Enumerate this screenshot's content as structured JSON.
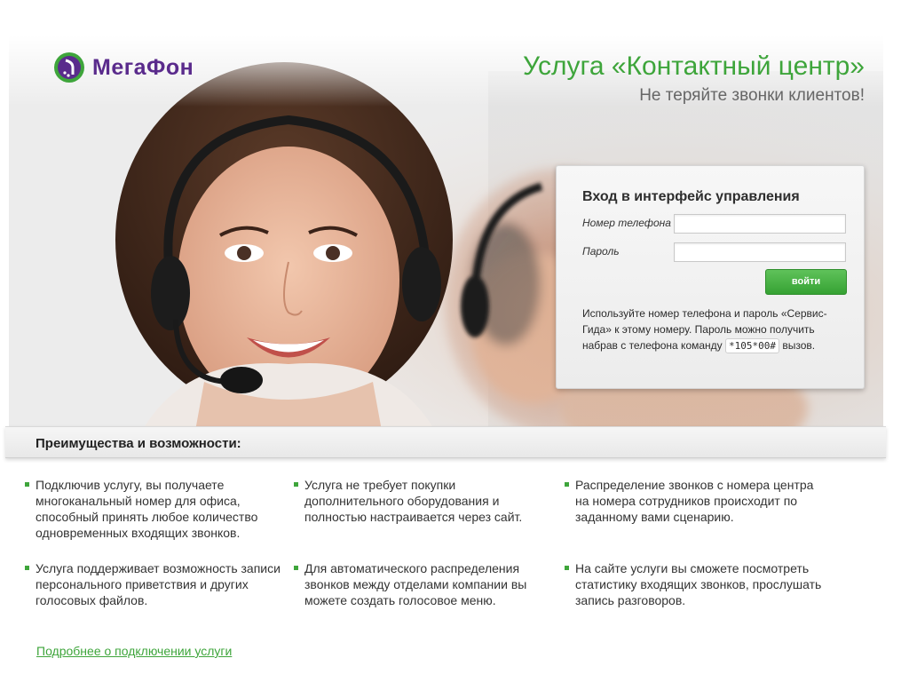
{
  "brand": {
    "name": "МегаФон"
  },
  "header": {
    "title": "Услуга «Контактный центр»",
    "subtitle": "Не теряйте звонки клиентов!"
  },
  "login": {
    "title": "Вход в интерфейс управления",
    "phone_label": "Номер телефона",
    "phone_value": "",
    "password_label": "Пароль",
    "password_value": "",
    "submit_label": "войти",
    "hint_before": "Используйте номер телефона и пароль «Сервис-Гида» к этому номеру. Пароль можно получить набрав с телефона команду",
    "hint_code": "*105*00#",
    "hint_after": "вызов."
  },
  "advantages": {
    "title": "Преимущества и возможности:",
    "items": [
      "Подключив услугу, вы получаете многоканальный номер для офиса, способный принять любое количество одновременных входящих звонков.",
      "Услуга не требует покупки дополнительного оборудования и полностью настраивается через сайт.",
      "Распределение звонков с номера центра на номера сотрудников происходит по заданному вами сценарию.",
      "Услуга поддерживает возможность записи персонального приветствия и других голосовых файлов.",
      "Для автоматического распределения звонков между отделами компании вы можете создать голосовое меню.",
      "На сайте услуги вы сможете посмотреть статистику входящих звонков, прослушать запись разговоров."
    ]
  },
  "footer": {
    "more_link": "Подробнее о подключении услуги"
  },
  "colors": {
    "brand_green": "#3ea53b",
    "brand_purple": "#5a2b8c"
  },
  "icons": {
    "logo": "megafon-logo-icon"
  }
}
